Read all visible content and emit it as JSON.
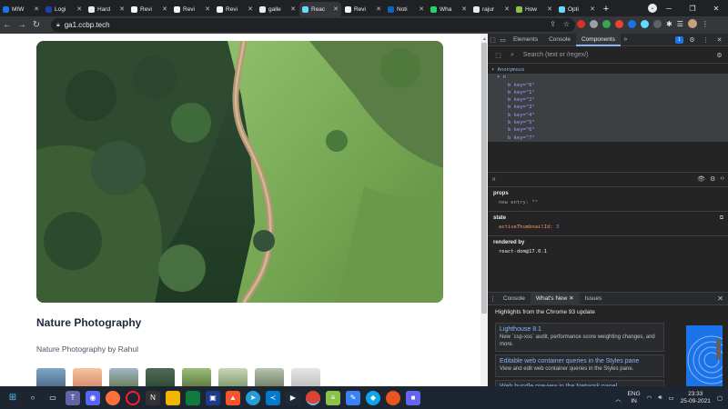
{
  "browser": {
    "tabs": [
      {
        "label": "MIW",
        "color": "#1a73e8",
        "active": false
      },
      {
        "label": "Logi",
        "color": "#1e40af",
        "active": false
      },
      {
        "label": "Hard",
        "color": "#e8eaed",
        "active": false
      },
      {
        "label": "Revi",
        "color": "#f1f5f9",
        "active": false
      },
      {
        "label": "Revi",
        "color": "#f1f5f9",
        "active": false
      },
      {
        "label": "Revi",
        "color": "#f1f5f9",
        "active": false
      },
      {
        "label": "galle",
        "color": "#e8eaed",
        "active": false
      },
      {
        "label": "Reac",
        "color": "#61dafb",
        "active": true
      },
      {
        "label": "Revi",
        "color": "#f1f5f9",
        "active": false
      },
      {
        "label": "Noti",
        "color": "#0a66c2",
        "active": false
      },
      {
        "label": "Wha",
        "color": "#25d366",
        "active": false
      },
      {
        "label": "rajur",
        "color": "#e8eaed",
        "active": false
      },
      {
        "label": "How",
        "color": "#8bc34a",
        "active": false
      },
      {
        "label": "Opti",
        "color": "#61dafb",
        "active": false
      }
    ],
    "new_tab": "+",
    "url": "ga1.ccbp.tech"
  },
  "page": {
    "title": "Nature Photography",
    "subtitle": "Nature Photography by Rahul",
    "thumbnails": [
      {
        "color_top": "#7fa6c7",
        "color_bottom": "#4b6a86"
      },
      {
        "color_top": "#f2c6a0",
        "color_bottom": "#d88a6a"
      },
      {
        "color_top": "#9fb6c9",
        "color_bottom": "#6a7d5a"
      },
      {
        "color_top": "#4f6b55",
        "color_bottom": "#2d4a34"
      },
      {
        "color_top": "#9dbb7a",
        "color_bottom": "#5b7a3f"
      },
      {
        "color_top": "#c9d6b8",
        "color_bottom": "#7f9a6a"
      },
      {
        "color_top": "#b7c4b0",
        "color_bottom": "#6f7e65"
      },
      {
        "color_top": "#e6e6e6",
        "color_bottom": "#bfbfbf"
      }
    ]
  },
  "devtools": {
    "tabs": [
      "Elements",
      "Console",
      "Components"
    ],
    "active_tab": "Components",
    "issues_count": "1",
    "search_placeholder": "Search (text or /regex/)",
    "tree": {
      "root": "Anonymous",
      "child": "n",
      "items": [
        {
          "component": "b",
          "key": "key=\"0\""
        },
        {
          "component": "b",
          "key": "key=\"1\""
        },
        {
          "component": "b",
          "key": "key=\"2\""
        },
        {
          "component": "b",
          "key": "key=\"3\""
        },
        {
          "component": "b",
          "key": "key=\"4\""
        },
        {
          "component": "b",
          "key": "key=\"5\""
        },
        {
          "component": "b",
          "key": "key=\"6\""
        },
        {
          "component": "b",
          "key": "key=\"7\""
        }
      ]
    },
    "inspector": {
      "selected": "n",
      "props_label": "props",
      "props_line_key": "new entry:",
      "props_line_val": "\"\"",
      "state_label": "state",
      "state_key": "activeThumbnailId:",
      "state_val": "3",
      "rendered_label": "rendered by",
      "rendered_val": "react-dom@17.0.1"
    },
    "drawer": {
      "tabs": [
        "Console",
        "What's New",
        "Issues"
      ],
      "active_tab": "What's New",
      "highlights": "Highlights from the Chrome 93 update",
      "cards": [
        {
          "title": "Lighthouse 8.1",
          "desc": "New `csp-xss` audit, performance score weighting changes, and more."
        },
        {
          "title": "Editable web container queries in the Styles pane",
          "desc": "View and edit web container queries in the Styles pane."
        },
        {
          "title": "Web bundle preview in the Network panel",
          "desc": ""
        }
      ]
    }
  },
  "taskbar": {
    "lang_line1": "ENG",
    "lang_line2": "IN",
    "time": "23:33",
    "date": "25-09-2021"
  }
}
